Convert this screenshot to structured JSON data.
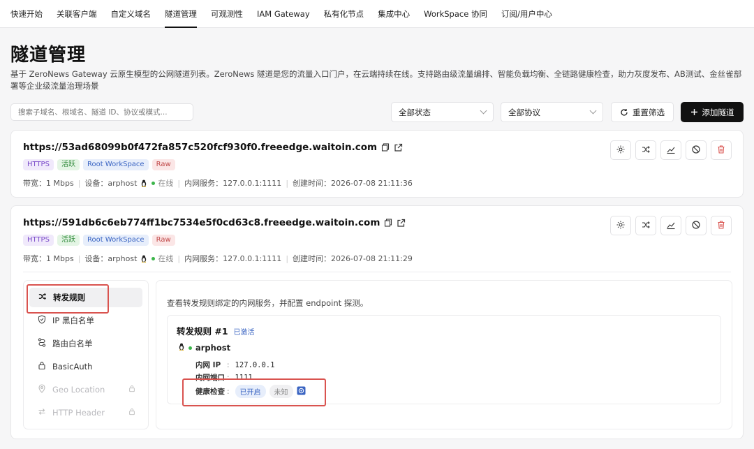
{
  "nav": {
    "items": [
      "快速开始",
      "关联客户端",
      "自定义域名",
      "隧道管理",
      "可观测性",
      "IAM Gateway",
      "私有化节点",
      "集成中心",
      "WorkSpace 协同",
      "订阅/用户中心"
    ],
    "active_index": 3
  },
  "page": {
    "title": "隧道管理",
    "description": "基于 ZeroNews Gateway 云原生模型的公网隧道列表。ZeroNews 隧道是您的流量入口门户，在云端持续在线。支持路由级流量编排、智能负载均衡、全链路健康检查，助力灰度发布、AB测试、金丝雀部署等企业级流量治理场景"
  },
  "toolbar": {
    "search_placeholder": "搜索子域名、根域名、隧道 ID、协议或模式...",
    "status_filter": "全部状态",
    "protocol_filter": "全部协议",
    "reset_label": "重置筛选",
    "add_label": "添加隧道"
  },
  "tunnels": [
    {
      "url": "https://53ad68099b0f472fa857c520fcf930f0.freeedge.waitoin.com",
      "tags": [
        "HTTPS",
        "活跃",
        "Root WorkSpace",
        "Raw"
      ],
      "bandwidth": "带宽：1 Mbps",
      "device": "设备：arphost",
      "online": "在线",
      "service": "内网服务：127.0.0.1:1111",
      "created": "创建时间：2026-07-08 21:11:36"
    },
    {
      "url": "https://591db6c6eb774ff1bc7534e5f0cd63c8.freeedge.waitoin.com",
      "tags": [
        "HTTPS",
        "活跃",
        "Root WorkSpace",
        "Raw"
      ],
      "bandwidth": "带宽：1 Mbps",
      "device": "设备：arphost",
      "online": "在线",
      "service": "内网服务：127.0.0.1:1111",
      "created": "创建时间：2026-07-08 21:11:29"
    }
  ],
  "side_menu": [
    "转发规则",
    "IP 黑白名单",
    "路由白名单",
    "BasicAuth",
    "Geo Location",
    "HTTP Header"
  ],
  "panel": {
    "description": "查看转发规则绑定的内网服务，并配置 endpoint 探测。",
    "rule_title": "转发规则 #1",
    "rule_status": "已激活",
    "host": "arphost",
    "ip_label": "内网 IP",
    "ip_value": "127.0.0.1",
    "port_label": "内网端口",
    "port_value": "1111",
    "health_label": "健康检查",
    "health_on": "已开启",
    "health_state": "未知"
  },
  "colors": {
    "accent": "#111111",
    "online": "#3cb54a",
    "highlight": "#d9534f"
  }
}
